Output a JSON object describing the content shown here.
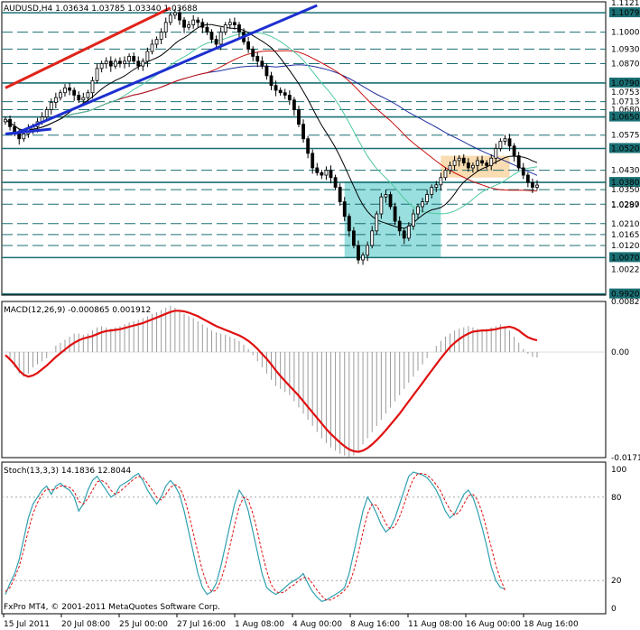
{
  "window": {
    "symbol_header": "AUDUSD,H4  1.03634 1.03785 1.03340 1.03688",
    "copyright": "FxPro MT4, © 2001-2011 MetaQuotes Software Corp."
  },
  "colors": {
    "hline": "#1a6f73",
    "up_trend": "#e0241b",
    "blue_trend": "#1d2fd0",
    "box_cyan": "#8fdcdc",
    "box_orange": "#f8d8a8",
    "ma_red": "#c81010",
    "ma_green": "#50c8a0",
    "ma_navy": "#2030a0",
    "ma_black": "#000000",
    "macd_signal": "#e01010",
    "stoch_main": "#30a0b0",
    "stoch_signal": "#e01010"
  },
  "chart_data": [
    {
      "type": "candlestick",
      "panel": "price",
      "ylim": [
        0.9915,
        1.1125
      ],
      "x_ticks": [
        "15 Jul 2011",
        "20 Jul 08:00",
        "25 Jul 00:00",
        "27 Jul 16:00",
        "1 Aug 08:00",
        "4 Aug 00:00",
        "8 Aug 16:00",
        "11 Aug 08:00",
        "16 Aug 00:00",
        "18 Aug 16:00"
      ],
      "axis_labels": [
        "1.11210",
        "1.10799",
        "1.10000",
        "1.09300",
        "1.08700",
        "1.07900",
        "1.07535",
        "1.07130",
        "1.06800",
        "1.06500",
        "1.05750",
        "1.05200",
        "1.04300",
        "1.03800",
        "1.03500",
        "1.02900",
        "1.02870",
        "1.02100",
        "1.01650",
        "1.01200",
        "1.00700",
        "1.00220",
        "0.99200"
      ],
      "horizontal_levels": [
        1.10799,
        1.1,
        1.093,
        1.087,
        1.079,
        1.0713,
        1.068,
        1.065,
        1.0575,
        1.052,
        1.043,
        1.038,
        1.035,
        1.029,
        1.021,
        1.0165,
        1.012,
        1.007,
        0.992
      ],
      "solid_levels": [
        1.10799,
        1.079,
        1.065,
        1.052,
        1.038,
        1.007,
        0.992
      ],
      "close": [
        1.064,
        1.061,
        1.059,
        1.056,
        1.058,
        1.06,
        1.061,
        1.063,
        1.065,
        1.068,
        1.071,
        1.073,
        1.075,
        1.077,
        1.076,
        1.074,
        1.072,
        1.073,
        1.075,
        1.08,
        1.085,
        1.087,
        1.088,
        1.086,
        1.088,
        1.087,
        1.088,
        1.09,
        1.088,
        1.086,
        1.088,
        1.092,
        1.095,
        1.097,
        1.1,
        1.104,
        1.107,
        1.108,
        1.105,
        1.102,
        1.103,
        1.105,
        1.104,
        1.102,
        1.1,
        1.097,
        1.095,
        1.1,
        1.103,
        1.104,
        1.103,
        1.1,
        1.096,
        1.093,
        1.09,
        1.088,
        1.086,
        1.082,
        1.078,
        1.076,
        1.075,
        1.074,
        1.072,
        1.068,
        1.062,
        1.056,
        1.05,
        1.044,
        1.042,
        1.041,
        1.043,
        1.04,
        1.036,
        1.03,
        1.024,
        1.018,
        1.012,
        1.006,
        1.008,
        1.012,
        1.018,
        1.025,
        1.032,
        1.033,
        1.028,
        1.022,
        1.018,
        1.015,
        1.02,
        1.025,
        1.028,
        1.03,
        1.033,
        1.036,
        1.037,
        1.04,
        1.043,
        1.045,
        1.047,
        1.048,
        1.046,
        1.044,
        1.045,
        1.047,
        1.046,
        1.045,
        1.048,
        1.052,
        1.055,
        1.056,
        1.053,
        1.049,
        1.044,
        1.041,
        1.038,
        1.036,
        1.0369
      ],
      "trend_lines": [
        {
          "color": "red",
          "from": [
            0,
            1.077
          ],
          "to": [
            36,
            1.11
          ]
        },
        {
          "color": "blue",
          "from": [
            2,
            1.058
          ],
          "to": [
            68,
            1.111
          ]
        },
        {
          "color": "blue",
          "from": [
            0,
            1.058
          ],
          "to": [
            10,
            1.06
          ]
        }
      ],
      "boxes": [
        {
          "color": "cyan",
          "x_range": [
            74,
            95
          ],
          "y_range": [
            1.007,
            1.0385
          ]
        },
        {
          "color": "orange",
          "x_range": [
            95,
            110
          ],
          "y_range": [
            1.04,
            1.049
          ]
        }
      ]
    },
    {
      "type": "bar+line",
      "panel": "macd",
      "title": "MACD(12,26,9) -0.000865 0.001912",
      "ylim": [
        -0.01714,
        0.00821
      ],
      "axis_labels": [
        "0.00821",
        "0.00",
        "-0.01714"
      ],
      "macd_hist": [
        0.0,
        -0.001,
        -0.0025,
        -0.0035,
        -0.004,
        -0.0035,
        -0.0025,
        -0.002,
        -0.0015,
        -0.001,
        0.0,
        0.001,
        0.0015,
        0.002,
        0.0025,
        0.003,
        0.003,
        0.0028,
        0.003,
        0.0035,
        0.004,
        0.0042,
        0.004,
        0.0038,
        0.004,
        0.0042,
        0.0045,
        0.0048,
        0.005,
        0.0052,
        0.0055,
        0.0058,
        0.0062,
        0.0065,
        0.0068,
        0.0072,
        0.0075,
        0.0072,
        0.0068,
        0.0062,
        0.0058,
        0.0055,
        0.005,
        0.0045,
        0.004,
        0.0035,
        0.0032,
        0.003,
        0.0028,
        0.0025,
        0.0022,
        0.0018,
        0.0012,
        0.0005,
        -0.0005,
        -0.0015,
        -0.0025,
        -0.0035,
        -0.0045,
        -0.0055,
        -0.006,
        -0.0065,
        -0.007,
        -0.008,
        -0.009,
        -0.01,
        -0.011,
        -0.012,
        -0.013,
        -0.014,
        -0.0148,
        -0.0155,
        -0.016,
        -0.0165,
        -0.0168,
        -0.017,
        -0.0168,
        -0.016,
        -0.015,
        -0.014,
        -0.013,
        -0.012,
        -0.011,
        -0.01,
        -0.009,
        -0.008,
        -0.007,
        -0.006,
        -0.005,
        -0.004,
        -0.003,
        -0.002,
        -0.001,
        0.0,
        0.001,
        0.0018,
        0.0025,
        0.003,
        0.0035,
        0.0038,
        0.004,
        0.0042,
        0.004,
        0.0038,
        0.0036,
        0.0038,
        0.004,
        0.0042,
        0.0045,
        0.0042,
        0.0035,
        0.0025,
        0.0015,
        0.0005,
        -0.0003,
        -0.0008,
        -0.0009
      ],
      "macd_signal": [
        -0.0005,
        -0.0012,
        -0.002,
        -0.003,
        -0.0037,
        -0.004,
        -0.0038,
        -0.0034,
        -0.0028,
        -0.0022,
        -0.0015,
        -0.0008,
        -0.0002,
        0.0004,
        0.001,
        0.0015,
        0.0019,
        0.0022,
        0.0024,
        0.0026,
        0.0029,
        0.0032,
        0.0034,
        0.0035,
        0.0036,
        0.0037,
        0.0039,
        0.0041,
        0.0043,
        0.0045,
        0.0047,
        0.005,
        0.0053,
        0.0056,
        0.0059,
        0.0062,
        0.0065,
        0.0067,
        0.0067,
        0.0066,
        0.0064,
        0.0061,
        0.0058,
        0.0054,
        0.005,
        0.0046,
        0.0042,
        0.0039,
        0.0036,
        0.0033,
        0.003,
        0.0027,
        0.0023,
        0.0018,
        0.0012,
        0.0005,
        -0.0003,
        -0.0011,
        -0.002,
        -0.003,
        -0.0039,
        -0.0047,
        -0.0055,
        -0.0063,
        -0.0071,
        -0.008,
        -0.0089,
        -0.0098,
        -0.0107,
        -0.0116,
        -0.0125,
        -0.0133,
        -0.014,
        -0.0147,
        -0.0153,
        -0.0158,
        -0.0161,
        -0.0162,
        -0.016,
        -0.0156,
        -0.015,
        -0.0143,
        -0.0135,
        -0.0127,
        -0.0118,
        -0.0109,
        -0.01,
        -0.009,
        -0.008,
        -0.007,
        -0.006,
        -0.005,
        -0.004,
        -0.003,
        -0.002,
        -0.001,
        -0.0001,
        0.0008,
        0.0015,
        0.0021,
        0.0026,
        0.003,
        0.0033,
        0.0034,
        0.0035,
        0.0035,
        0.0036,
        0.0037,
        0.0039,
        0.004,
        0.0041,
        0.0039,
        0.0035,
        0.0029,
        0.0024,
        0.0021,
        0.0019
      ]
    },
    {
      "type": "line",
      "panel": "stochastic",
      "title": "Stoch(13,3,3) 14.1836 12.8044",
      "ylim": [
        0,
        100
      ],
      "axis_labels": [
        "100",
        "80",
        "20",
        "0"
      ],
      "stoch_main": [
        10,
        18,
        25,
        35,
        50,
        65,
        75,
        80,
        85,
        88,
        82,
        88,
        90,
        87,
        85,
        80,
        70,
        75,
        85,
        92,
        95,
        90,
        85,
        80,
        82,
        88,
        90,
        92,
        95,
        97,
        92,
        85,
        80,
        75,
        80,
        88,
        92,
        88,
        82,
        70,
        55,
        40,
        25,
        15,
        10,
        12,
        18,
        30,
        45,
        60,
        75,
        85,
        80,
        70,
        55,
        40,
        25,
        15,
        12,
        10,
        12,
        15,
        18,
        20,
        22,
        25,
        18,
        12,
        8,
        5,
        6,
        8,
        10,
        12,
        15,
        25,
        40,
        55,
        70,
        80,
        75,
        68,
        60,
        55,
        58,
        65,
        75,
        85,
        95,
        98,
        97,
        96,
        94,
        90,
        85,
        78,
        70,
        65,
        68,
        75,
        82,
        85,
        80,
        70,
        58,
        45,
        30,
        20,
        15,
        14
      ],
      "stoch_signal": [
        12,
        15,
        22,
        30,
        42,
        56,
        68,
        76,
        82,
        86,
        85,
        86,
        88,
        88,
        87,
        84,
        77,
        75,
        79,
        85,
        91,
        92,
        90,
        85,
        82,
        84,
        87,
        90,
        93,
        95,
        94,
        90,
        85,
        80,
        78,
        82,
        87,
        89,
        87,
        80,
        68,
        54,
        40,
        27,
        17,
        12,
        13,
        20,
        31,
        45,
        60,
        73,
        80,
        78,
        68,
        55,
        40,
        27,
        17,
        12,
        11,
        12,
        15,
        17,
        20,
        22,
        22,
        18,
        13,
        9,
        6,
        6,
        8,
        10,
        13,
        17,
        27,
        40,
        55,
        68,
        75,
        74,
        68,
        61,
        57,
        59,
        66,
        75,
        85,
        93,
        97,
        97,
        96,
        93,
        89,
        84,
        77,
        71,
        67,
        69,
        75,
        81,
        82,
        78,
        69,
        57,
        44,
        31,
        21,
        13
      ]
    }
  ]
}
